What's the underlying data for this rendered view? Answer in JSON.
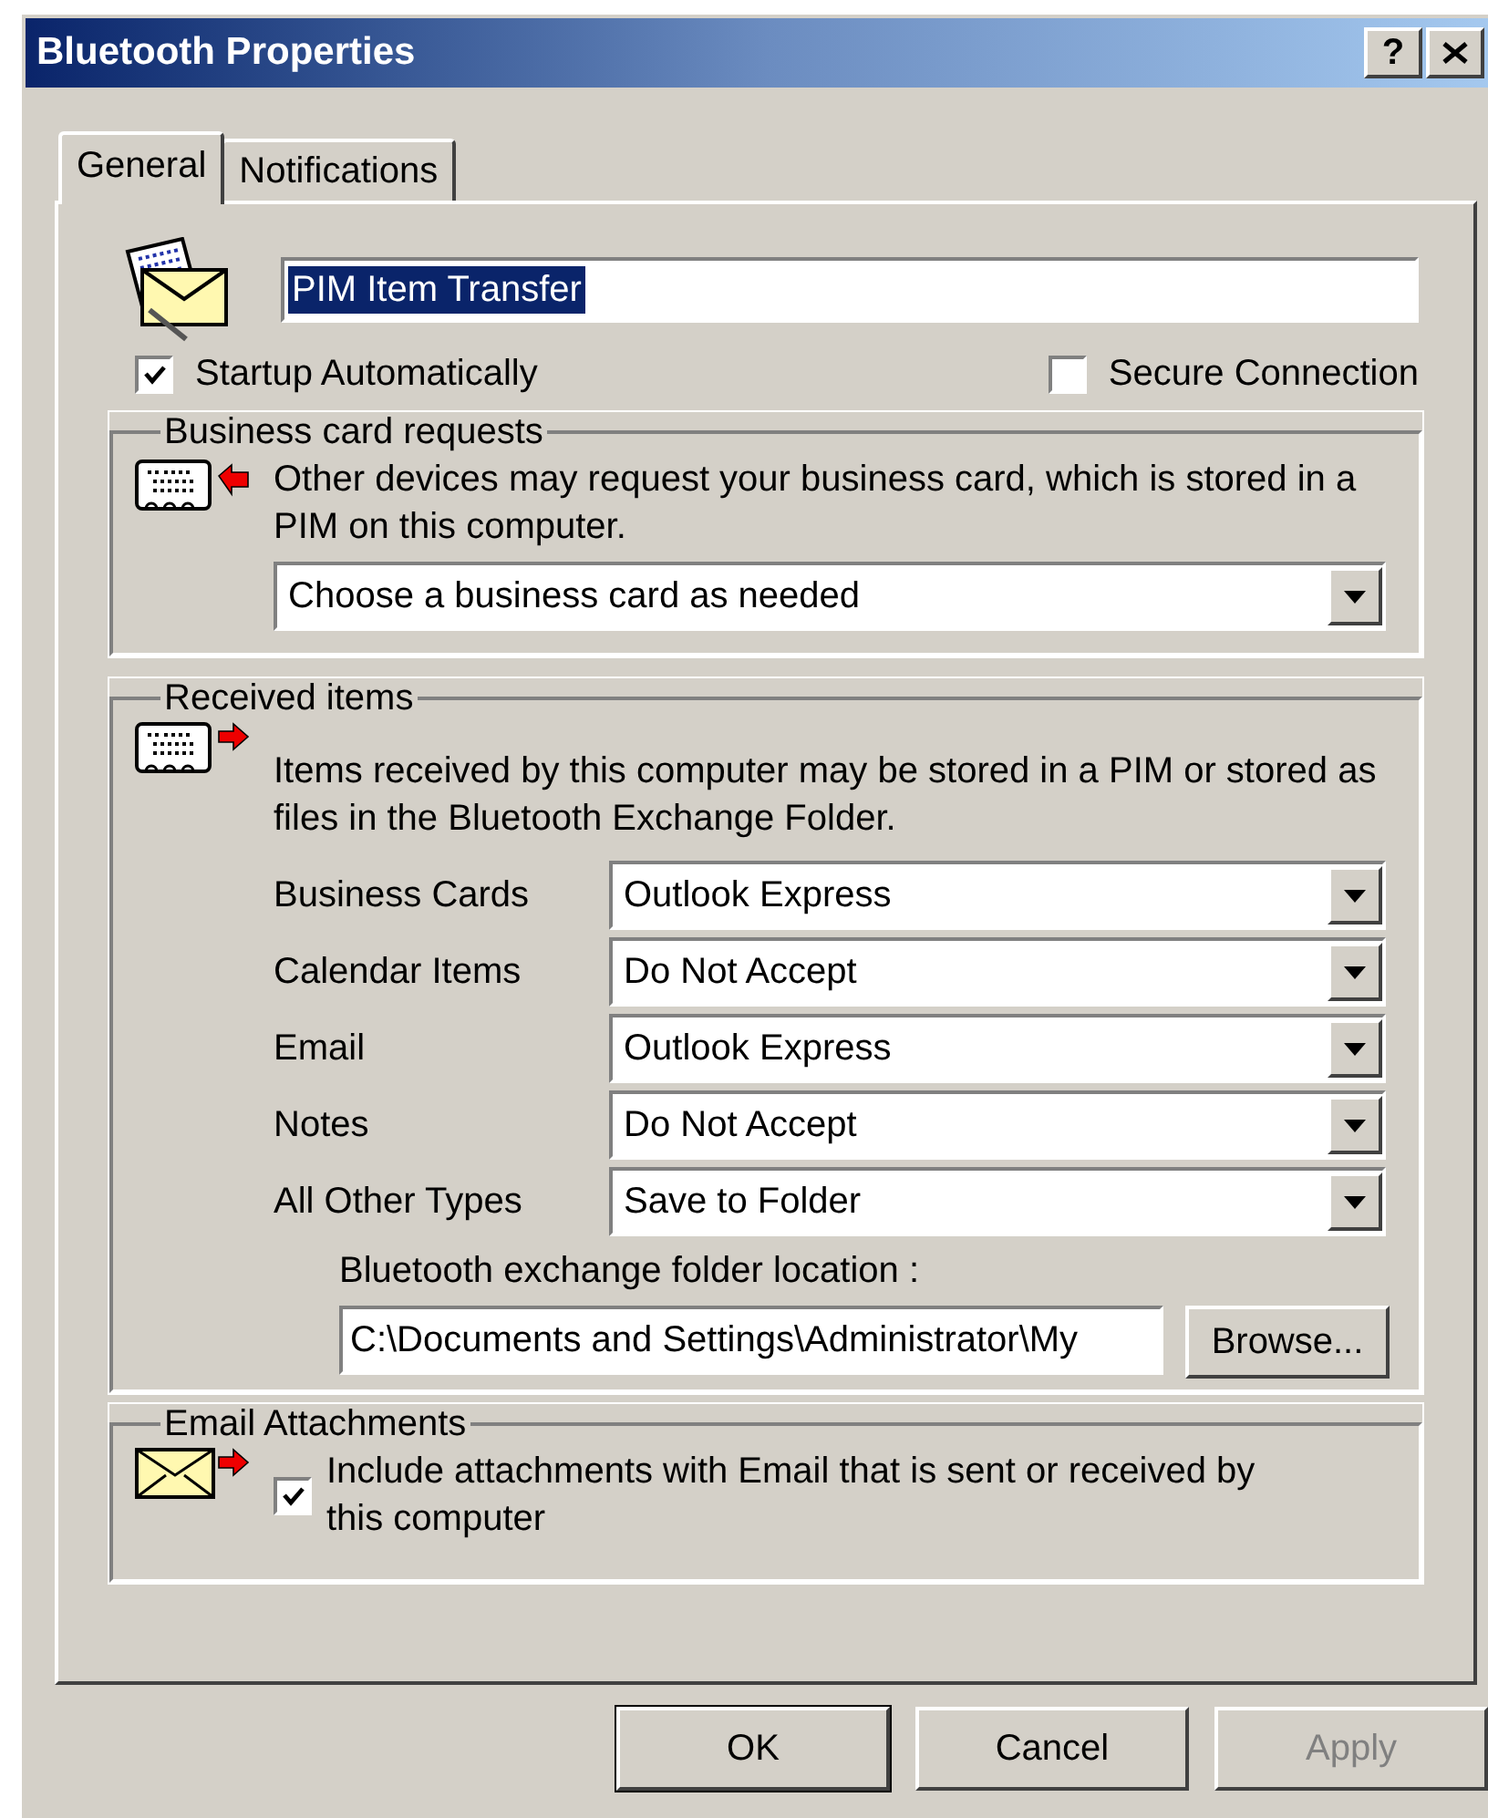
{
  "window": {
    "title": "Bluetooth Properties",
    "help_button": "?"
  },
  "tabs": [
    {
      "label": "General",
      "selected": true
    },
    {
      "label": "Notifications",
      "selected": false
    }
  ],
  "service": {
    "name": "PIM Item Transfer",
    "text_selected": true
  },
  "options": [
    {
      "label": "Startup Automatically",
      "checked": true
    },
    {
      "label": "Secure Connection",
      "checked": false
    }
  ],
  "business_card_requests": {
    "title": "Business card requests",
    "description": "Other devices may request your business card, which is stored in a PIM on this computer.",
    "dropdown": "Choose a business card as needed"
  },
  "received_items": {
    "title": "Received items",
    "description": "Items received by this computer may be stored in a PIM or stored as files in the Bluetooth Exchange Folder.",
    "rows": [
      {
        "label": "Business Cards",
        "value": "Outlook Express"
      },
      {
        "label": "Calendar Items",
        "value": "Do Not Accept"
      },
      {
        "label": "Email",
        "value": "Outlook Express"
      },
      {
        "label": "Notes",
        "value": "Do Not Accept"
      },
      {
        "label": "All Other Types",
        "value": "Save to Folder"
      }
    ],
    "folder_label": "Bluetooth exchange folder location :",
    "folder_path": "C:\\Documents and Settings\\Administrator\\My",
    "browse_button": "Browse..."
  },
  "email_attachments": {
    "title": "Email Attachments",
    "option": {
      "label": "Include attachments with Email that is sent or received by this computer",
      "checked": true
    }
  },
  "buttons": [
    {
      "label": "OK",
      "disabled": false,
      "default": true
    },
    {
      "label": "Cancel",
      "disabled": false,
      "default": false
    },
    {
      "label": "Apply",
      "disabled": true,
      "default": false
    }
  ]
}
